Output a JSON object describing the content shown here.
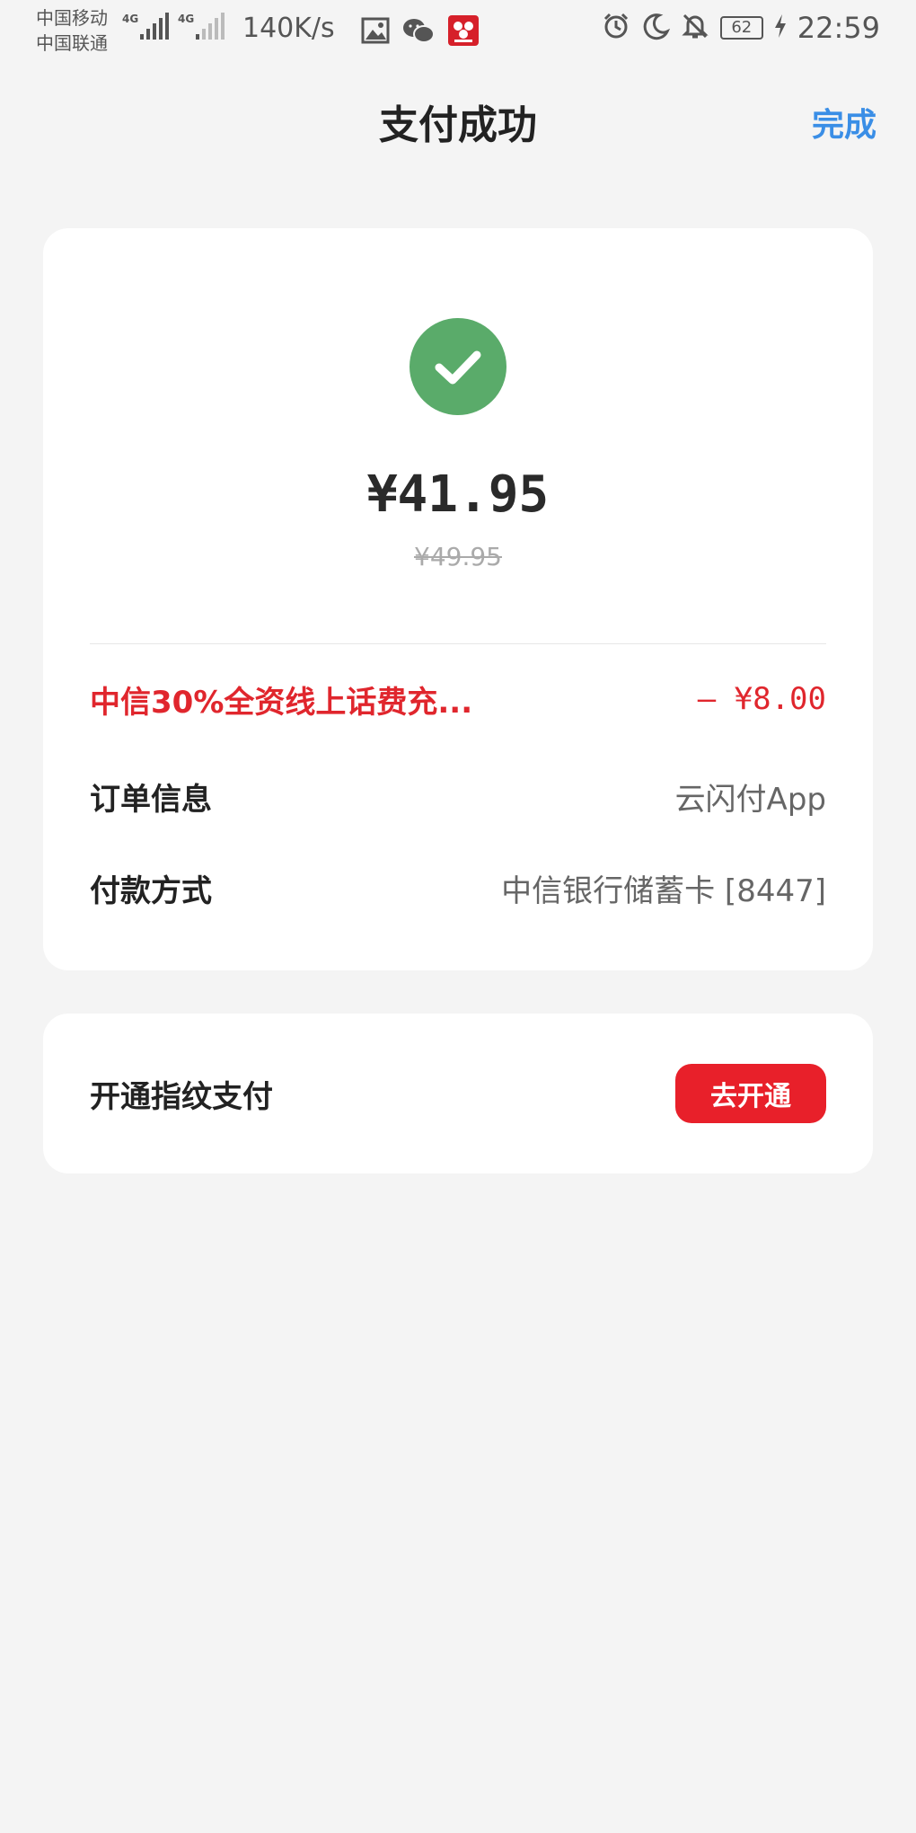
{
  "status_bar": {
    "carrier_1": "中国移动",
    "carrier_2": "中国联通",
    "network_1": "4G",
    "network_2": "4G",
    "net_speed": "140K/s",
    "battery": "62",
    "time": "22:59",
    "icons": [
      "gallery-icon",
      "wechat-icon",
      "app-notification-icon",
      "alarm-icon",
      "moon-icon",
      "mute-icon",
      "charging-icon"
    ]
  },
  "header": {
    "title": "支付成功",
    "done_label": "完成",
    "done_color": "#3a8ee6"
  },
  "payment": {
    "amount": "¥41.95",
    "original_amount": "¥49.95",
    "success_color": "#5aab6a",
    "discount": {
      "label": "中信30%全资线上话费充...",
      "value": "– ¥8.00",
      "color": "#e0262d"
    },
    "order_info": {
      "label": "订单信息",
      "value": "云闪付App"
    },
    "payment_method": {
      "label": "付款方式",
      "value": "中信银行储蓄卡 [8447]"
    }
  },
  "fingerprint": {
    "label": "开通指纹支付",
    "button_label": "去开通",
    "button_color": "#e8202a"
  }
}
